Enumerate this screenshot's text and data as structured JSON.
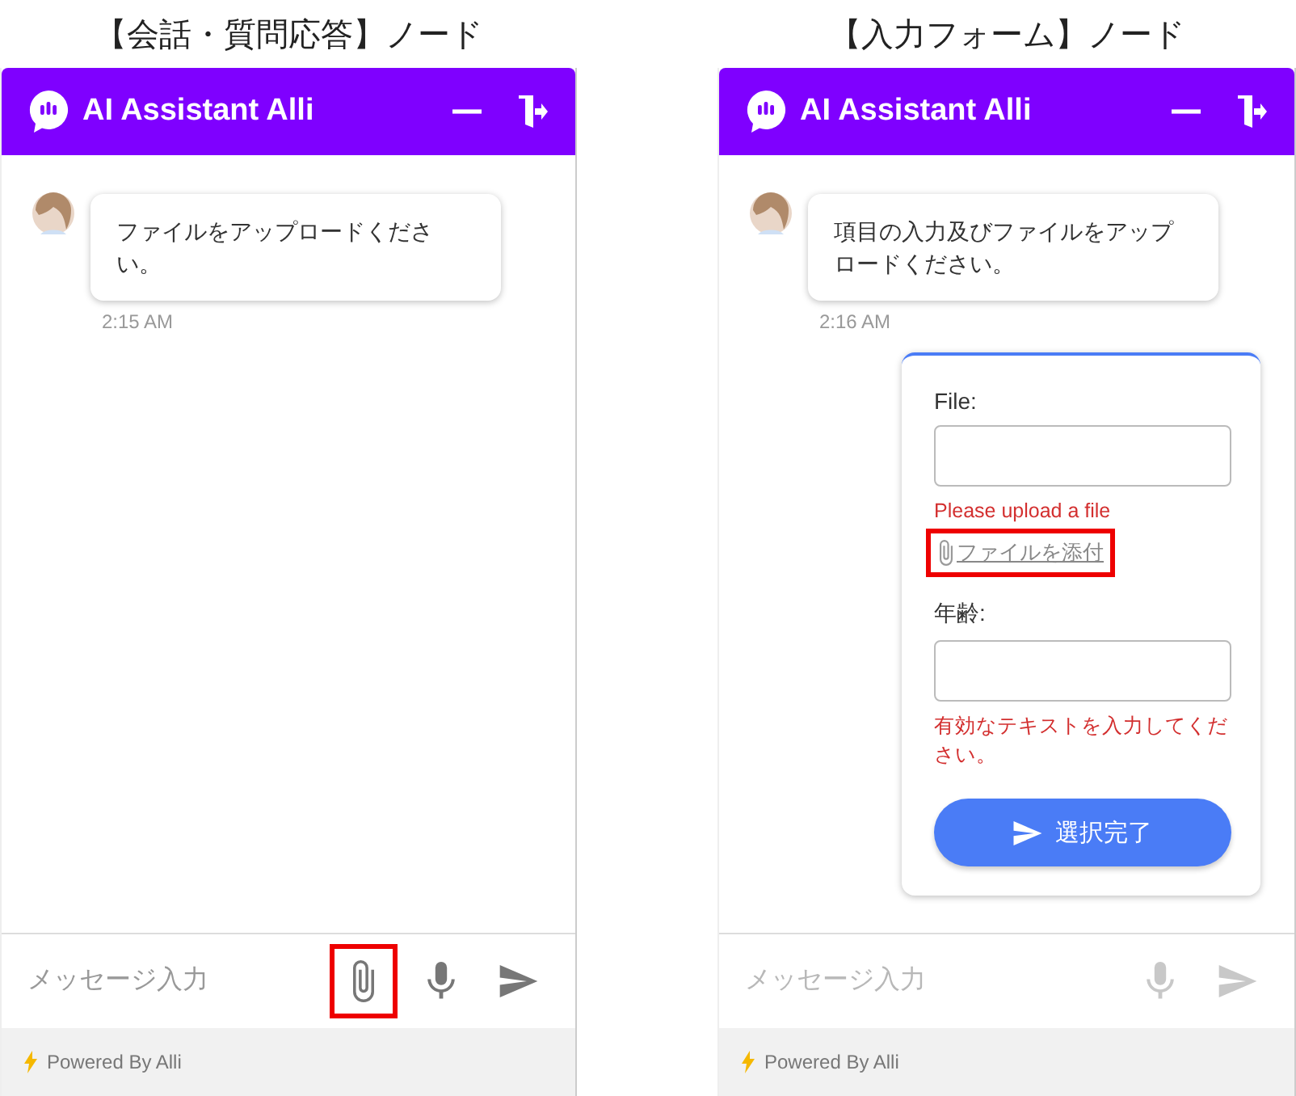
{
  "panels": [
    {
      "caption": "【会話・質問応答】ノード",
      "header": {
        "title": "AI Assistant Alli"
      },
      "messages": [
        {
          "text": "ファイルをアップロードください。",
          "time": "2:15 AM"
        }
      ],
      "composer": {
        "placeholder": "メッセージ入力",
        "disabled": false,
        "buttons": [
          {
            "kind": "attach",
            "highlighted": true
          },
          {
            "kind": "mic",
            "highlighted": false
          },
          {
            "kind": "send",
            "highlighted": false
          }
        ]
      },
      "footer": "Powered By Alli"
    },
    {
      "caption": "【入力フォーム】ノード",
      "header": {
        "title": "AI Assistant Alli"
      },
      "messages": [
        {
          "text": "項目の入力及びファイルをアップロードください。",
          "time": "2:16 AM"
        }
      ],
      "form": {
        "fields": [
          {
            "label": "File:",
            "error": "Please upload a file",
            "attach_link": {
              "text": "ファイルを添付",
              "highlighted": true
            }
          },
          {
            "label": "年齢:",
            "error": "有効なテキストを入力してください。"
          }
        ],
        "submit": "選択完了"
      },
      "composer": {
        "placeholder": "メッセージ入力",
        "disabled": true,
        "buttons": [
          {
            "kind": "mic",
            "highlighted": false
          },
          {
            "kind": "send",
            "highlighted": false
          }
        ]
      },
      "footer": "Powered By Alli"
    }
  ]
}
